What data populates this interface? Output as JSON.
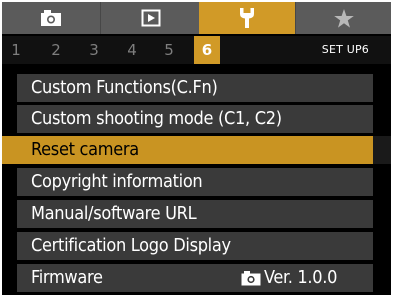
{
  "tabs": [
    {
      "icon": "camera-icon"
    },
    {
      "icon": "playback-icon"
    },
    {
      "icon": "wrench-icon",
      "active": true
    },
    {
      "icon": "star-icon"
    }
  ],
  "subtabs": {
    "numbers": [
      "1",
      "2",
      "3",
      "4",
      "5",
      "6"
    ],
    "active_index": 5,
    "label": "SET UP6"
  },
  "menu": {
    "items": [
      {
        "label": "Custom Functions(C.Fn)"
      },
      {
        "label": "Custom shooting mode (C1, C2)"
      },
      {
        "label": "Reset camera",
        "selected": true
      },
      {
        "label": "Copyright information"
      },
      {
        "label": "Manual/software URL"
      },
      {
        "label": "Certification Logo Display"
      },
      {
        "label": "Firmware",
        "value": "Ver. 1.0.0",
        "value_icon": "camera-icon"
      }
    ]
  },
  "colors": {
    "accent": "#d19a27",
    "selected_row": "#c99422",
    "row_bg": "#3a3a3a",
    "tab_bar_bg": "#5b5b5b",
    "screen_bg": "#000000"
  }
}
